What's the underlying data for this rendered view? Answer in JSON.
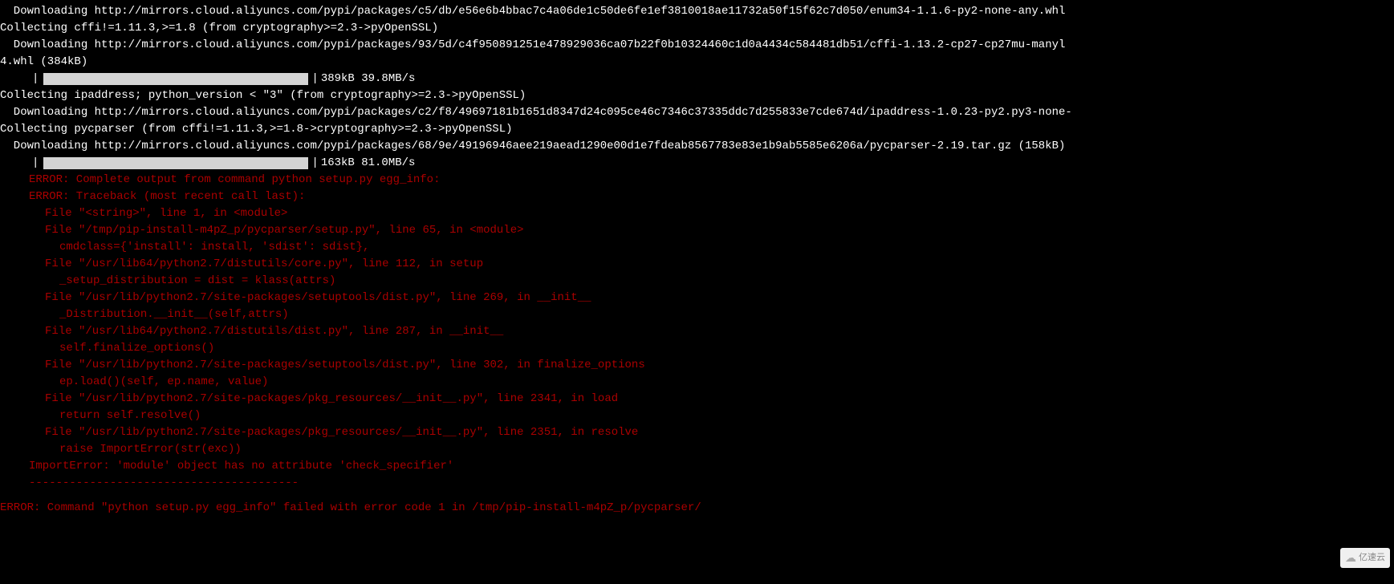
{
  "lines": {
    "l1": "  Downloading http://mirrors.cloud.aliyuncs.com/pypi/packages/c5/db/e56e6b4bbac7c4a06de1c50de6fe1ef3810018ae11732a50f15f62c7d050/enum34-1.1.6-py2-none-any.whl",
    "l2": "Collecting cffi!=1.11.3,>=1.8 (from cryptography>=2.3->pyOpenSSL)",
    "l3": "  Downloading http://mirrors.cloud.aliyuncs.com/pypi/packages/93/5d/c4f950891251e478929036ca07b22f0b10324460c1d0a4434c584481db51/cffi-1.13.2-cp27-cp27mu-manyl",
    "l4": "4.whl (384kB)",
    "progress1": "389kB 39.8MB/s",
    "l5": "Collecting ipaddress; python_version < \"3\" (from cryptography>=2.3->pyOpenSSL)",
    "l6": "  Downloading http://mirrors.cloud.aliyuncs.com/pypi/packages/c2/f8/49697181b1651d8347d24c095ce46c7346c37335ddc7d255833e7cde674d/ipaddress-1.0.23-py2.py3-none-",
    "l7": "Collecting pycparser (from cffi!=1.11.3,>=1.8->cryptography>=2.3->pyOpenSSL)",
    "l8": "  Downloading http://mirrors.cloud.aliyuncs.com/pypi/packages/68/9e/49196946aee219aead1290e00d1e7fdeab8567783e83e1b9ab5585e6206a/pycparser-2.19.tar.gz (158kB)",
    "progress2": "163kB 81.0MB/s"
  },
  "errors": {
    "e1": "ERROR: Complete output from command python setup.py egg_info:",
    "e2": "ERROR: Traceback (most recent call last):",
    "e3": "File \"<string>\", line 1, in <module>",
    "e4": "File \"/tmp/pip-install-m4pZ_p/pycparser/setup.py\", line 65, in <module>",
    "e5": "cmdclass={'install': install, 'sdist': sdist},",
    "e6": "File \"/usr/lib64/python2.7/distutils/core.py\", line 112, in setup",
    "e7": "_setup_distribution = dist = klass(attrs)",
    "e8": "File \"/usr/lib/python2.7/site-packages/setuptools/dist.py\", line 269, in __init__",
    "e9": "_Distribution.__init__(self,attrs)",
    "e10": "File \"/usr/lib64/python2.7/distutils/dist.py\", line 287, in __init__",
    "e11": "self.finalize_options()",
    "e12": "File \"/usr/lib/python2.7/site-packages/setuptools/dist.py\", line 302, in finalize_options",
    "e13": "ep.load()(self, ep.name, value)",
    "e14": "File \"/usr/lib/python2.7/site-packages/pkg_resources/__init__.py\", line 2341, in load",
    "e15": "return self.resolve()",
    "e16": "File \"/usr/lib/python2.7/site-packages/pkg_resources/__init__.py\", line 2351, in resolve",
    "e17": "raise ImportError(str(exc))",
    "e18": "ImportError: 'module' object has no attribute 'check_specifier'",
    "separator": "----------------------------------------",
    "final": "ERROR: Command \"python setup.py egg_info\" failed with error code 1 in /tmp/pip-install-m4pZ_p/pycparser/"
  },
  "watermark": {
    "text": "亿速云"
  }
}
